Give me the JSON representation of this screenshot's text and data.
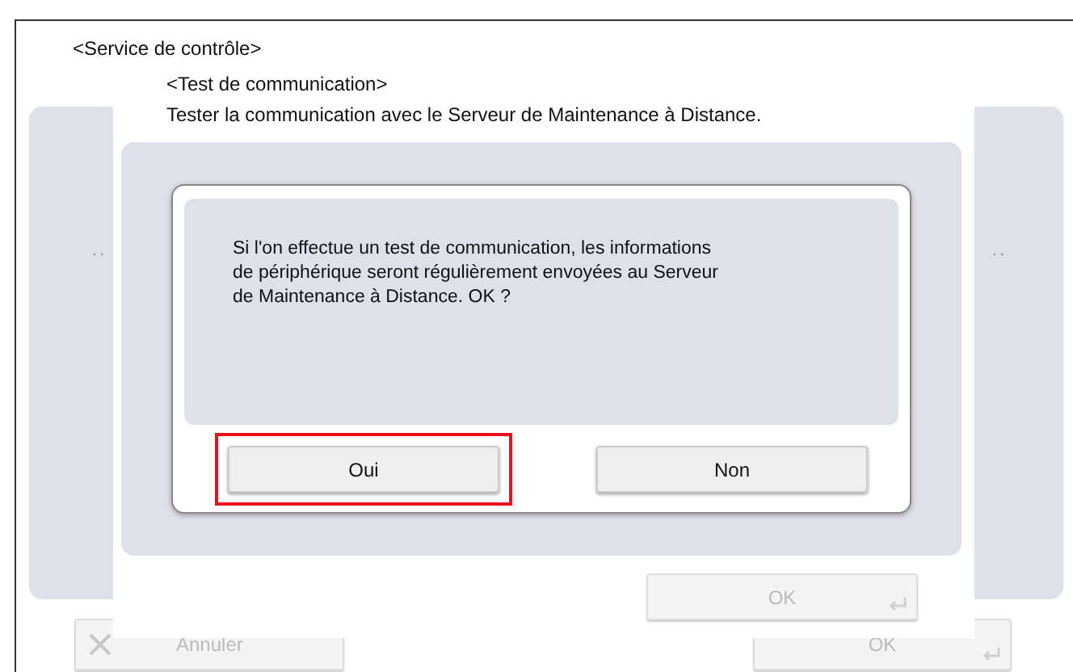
{
  "screen": {
    "title": "<Service de contrôle>",
    "side_marks": [
      "..",
      ".."
    ],
    "buttons": [
      {
        "label": "Annuler",
        "kind": "cancel",
        "disabled": true
      },
      {
        "label": "OK",
        "kind": "ok",
        "disabled": true
      }
    ]
  },
  "panel": {
    "title": "<Test de communication>",
    "description": "Tester la communication avec le Serveur de Maintenance à Distance.",
    "ok_button": {
      "label": "OK",
      "disabled": true
    }
  },
  "dialog": {
    "message": "Si l'on effectue un test de communication, les informations\nde périphérique seront régulièrement envoyées au Serveur\nde Maintenance à Distance. OK ?",
    "buttons": [
      {
        "label": "Oui",
        "selected": true
      },
      {
        "label": "Non",
        "selected": false
      }
    ]
  }
}
